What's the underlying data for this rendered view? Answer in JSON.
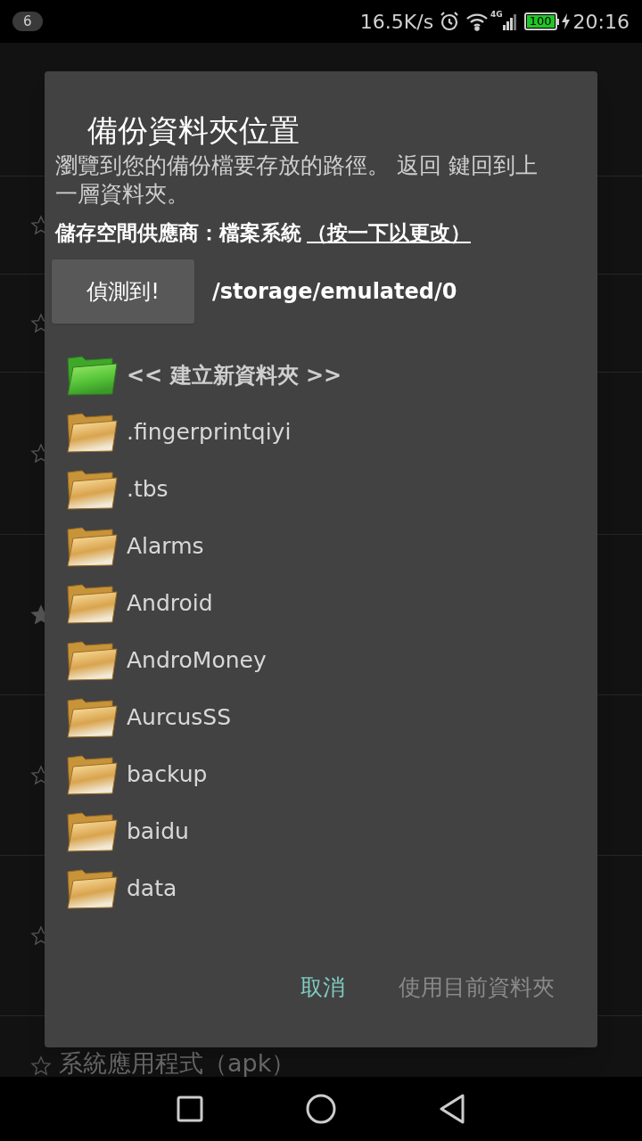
{
  "status_bar": {
    "notification_count": "6",
    "speed": "16.5K/s",
    "network": "4G",
    "battery": "100",
    "time": "20:16"
  },
  "background": {
    "rows": [
      {
        "starred": false
      },
      {
        "starred": false
      },
      {
        "starred": false
      },
      {
        "starred": true
      },
      {
        "starred": false
      },
      {
        "starred": false
      }
    ],
    "last_row": {
      "starred": false,
      "label": "系統應用程式（apk）"
    }
  },
  "dialog": {
    "title": "備份資料夾位置",
    "description": "瀏覽到您的備份檔要存放的路徑。 返回 鍵回到上一層資料夾。",
    "provider_label": "儲存空間供應商：檔案系統",
    "provider_link": "（按一下以更改）",
    "detect_button": "偵測到!",
    "path": "/storage/emulated/0",
    "folders": [
      {
        "kind": "new",
        "name": "<< 建立新資料夾 >>"
      },
      {
        "kind": "folder",
        "name": ".fingerprintqiyi"
      },
      {
        "kind": "folder",
        "name": ".tbs"
      },
      {
        "kind": "folder",
        "name": "Alarms"
      },
      {
        "kind": "folder",
        "name": "Android"
      },
      {
        "kind": "folder",
        "name": "AndroMoney"
      },
      {
        "kind": "folder",
        "name": "AurcusSS"
      },
      {
        "kind": "folder",
        "name": "backup"
      },
      {
        "kind": "folder",
        "name": "baidu"
      },
      {
        "kind": "folder",
        "name": "data"
      }
    ],
    "buttons": [
      {
        "label": "取消",
        "disabled": false
      },
      {
        "label": "使用目前資料夾",
        "disabled": true
      }
    ]
  }
}
